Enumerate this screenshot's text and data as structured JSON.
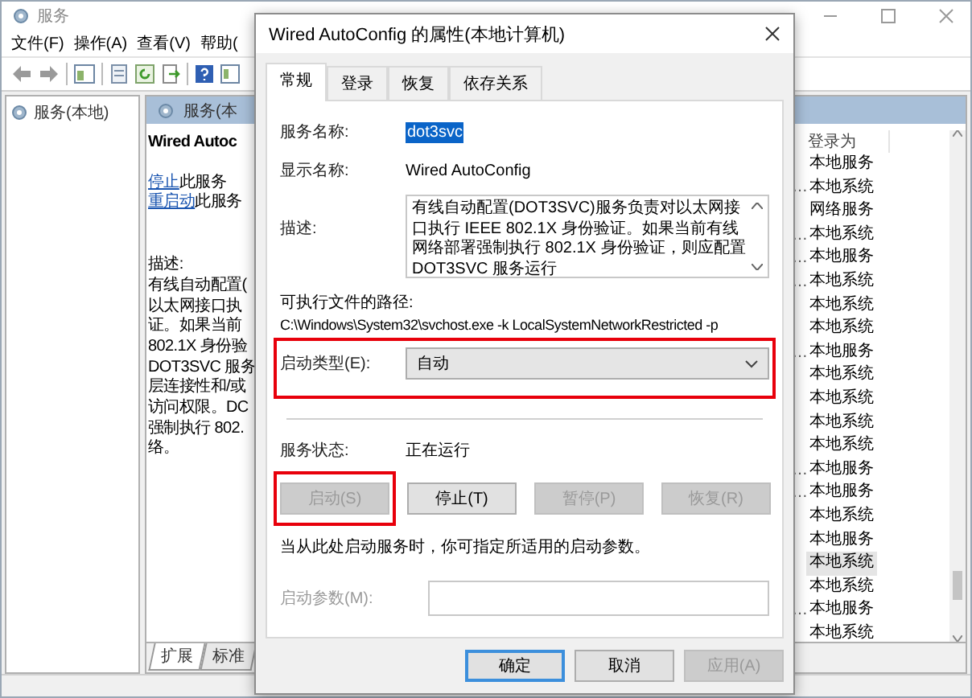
{
  "main_window": {
    "title": "服务",
    "menu": [
      "文件(F)",
      "操作(A)",
      "查看(V)",
      "帮助("
    ],
    "tree": [
      "服务(本地)"
    ],
    "pane_header": "服务(本",
    "detail": {
      "title": "Wired Autoc",
      "actions": [
        {
          "link": "停止",
          "rest": "此服务"
        },
        {
          "link": "重启动",
          "rest": "此服务"
        }
      ],
      "description_label": "描述:",
      "description_lines": [
        "有线自动配置(",
        "以太网接口执",
        "证。如果当前",
        "802.1X 身份验",
        "DOT3SVC 服务",
        "层连接性和/或",
        "访问权限。DC",
        "强制执行 802.",
        "络。"
      ]
    },
    "list": {
      "columns": [
        "登录为"
      ],
      "rows": [
        {
          "log_on_as": "本地服务",
          "selected": false
        },
        {
          "column_1": "…",
          "log_on_as": "本地系统",
          "selected": false
        },
        {
          "log_on_as": "网络服务",
          "selected": false
        },
        {
          "column_1": "…",
          "log_on_as": "本地系统",
          "selected": false
        },
        {
          "column_1": "…",
          "log_on_as": "本地服务",
          "selected": false
        },
        {
          "column_1": "…",
          "log_on_as": "本地系统",
          "selected": false
        },
        {
          "log_on_as": "本地系统",
          "selected": false
        },
        {
          "log_on_as": "本地系统",
          "selected": false
        },
        {
          "column_1": "…",
          "log_on_as": "本地服务",
          "selected": false
        },
        {
          "log_on_as": "本地系统",
          "selected": false
        },
        {
          "log_on_as": "本地系统",
          "selected": false
        },
        {
          "log_on_as": "本地系统",
          "selected": false
        },
        {
          "log_on_as": "本地系统",
          "selected": false
        },
        {
          "column_1": "…",
          "log_on_as": "本地服务",
          "selected": false
        },
        {
          "column_1": "…",
          "log_on_as": "本地服务",
          "selected": false
        },
        {
          "log_on_as": "本地系统",
          "selected": false
        },
        {
          "log_on_as": "本地服务",
          "selected": false
        },
        {
          "log_on_as": "本地系统",
          "selected": true
        },
        {
          "log_on_as": "本地系统",
          "selected": false
        },
        {
          "column_1": "…",
          "log_on_as": "本地服务",
          "selected": false
        },
        {
          "log_on_as": "本地系统",
          "selected": false
        }
      ]
    },
    "view_tabs": [
      {
        "label": "扩展",
        "selected": true
      },
      {
        "label": "标准",
        "selected": false
      }
    ]
  },
  "dialog": {
    "title": "Wired AutoConfig 的属性(本地计算机)",
    "tabs": [
      {
        "label": "常规",
        "selected": true
      },
      {
        "label": "登录",
        "selected": false
      },
      {
        "label": "恢复",
        "selected": false
      },
      {
        "label": "依存关系",
        "selected": false
      }
    ],
    "service_name": {
      "label": "服务名称:",
      "value": "dot3svc",
      "selected": true
    },
    "display_name": {
      "label": "显示名称:",
      "value": "Wired AutoConfig"
    },
    "description": {
      "label": "描述:",
      "value": "有线自动配置(DOT3SVC)服务负责对以太网接口执行 IEEE 802.1X 身份验证。如果当前有线网络部署强制执行 802.1X 身份验证，则应配置 DOT3SVC 服务运行"
    },
    "path": {
      "label": "可执行文件的路径:",
      "value": "C:\\Windows\\System32\\svchost.exe -k LocalSystemNetworkRestricted -p"
    },
    "startup_type": {
      "label": "启动类型(E):",
      "value": "自动",
      "highlighted": true
    },
    "status": {
      "label": "服务状态:",
      "value": "正在运行"
    },
    "service_buttons": [
      {
        "label": "启动(S)",
        "disabled": true,
        "highlighted": true
      },
      {
        "label": "停止(T)",
        "disabled": false,
        "highlighted": false
      },
      {
        "label": "暂停(P)",
        "disabled": true,
        "highlighted": false
      },
      {
        "label": "恢复(R)",
        "disabled": true,
        "highlighted": false
      }
    ],
    "hint": "当从此处启动服务时，你可指定所适用的启动参数。",
    "start_params": {
      "label": "启动参数(M):",
      "disabled": true
    },
    "buttons": [
      {
        "label": "确定",
        "default": true,
        "disabled": false
      },
      {
        "label": "取消",
        "default": false,
        "disabled": false
      },
      {
        "label": "应用(A)",
        "default": false,
        "disabled": true
      }
    ]
  }
}
